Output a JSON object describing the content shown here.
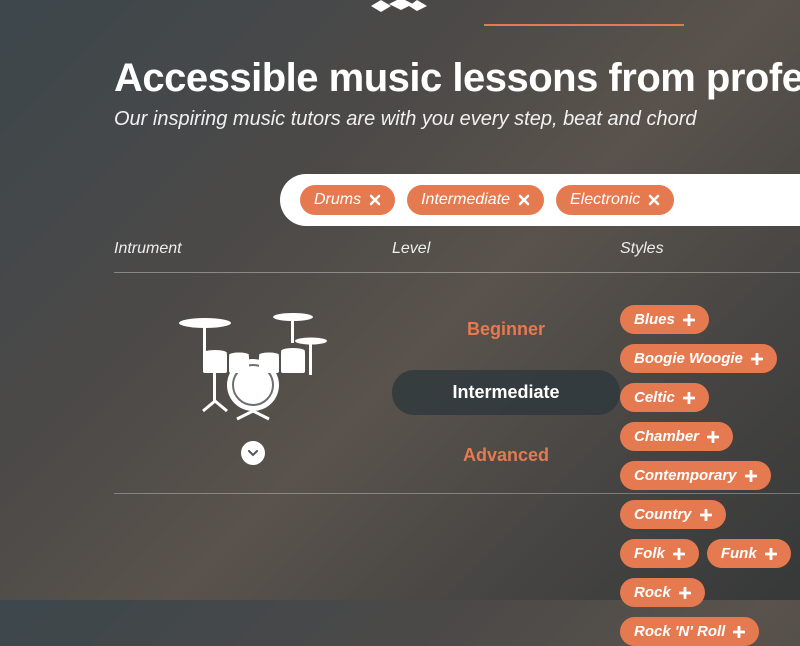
{
  "headline": "Accessible music lessons from professionals",
  "subhead": "Our inspiring music tutors are with you every step, beat and chord",
  "filters": {
    "selected": [
      {
        "label": "Drums"
      },
      {
        "label": "Intermediate"
      },
      {
        "label": "Electronic"
      }
    ]
  },
  "columns": {
    "instrument_header": "Intrument",
    "level_header": "Level",
    "styles_header": "Styles"
  },
  "levels": {
    "beginner": "Beginner",
    "intermediate": "Intermediate",
    "advanced": "Advanced",
    "selected": "intermediate"
  },
  "styles": {
    "row1": [
      {
        "label": "Blues"
      },
      {
        "label": "Boogie Woogie"
      }
    ],
    "row2": [
      {
        "label": "Celtic"
      },
      {
        "label": "Chamber"
      }
    ],
    "row3": [
      {
        "label": "Contemporary"
      },
      {
        "label": "Country"
      }
    ],
    "row4": [
      {
        "label": "Folk"
      },
      {
        "label": "Funk"
      }
    ],
    "row5": [
      {
        "label": "Rock"
      },
      {
        "label": "Rock 'N' Roll"
      }
    ]
  },
  "colors": {
    "accent": "#e57a50"
  }
}
